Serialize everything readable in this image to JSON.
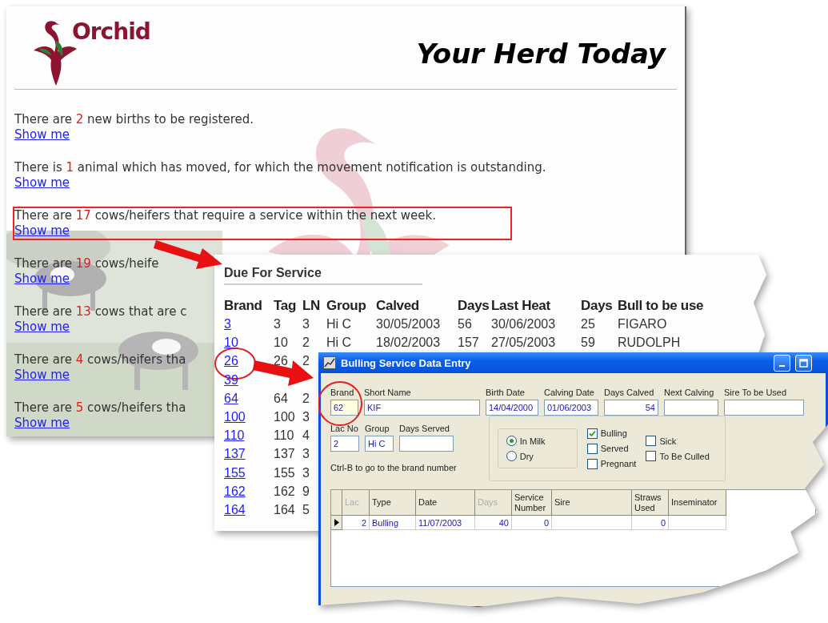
{
  "herd_page": {
    "logo": {
      "text": "Orchid"
    },
    "title": "Your Herd Today",
    "items": [
      {
        "prefix": "There are ",
        "count": "2",
        "suffix": " new births to be registered.",
        "link": "Show me",
        "highlighted": false
      },
      {
        "prefix": "There is ",
        "count": "1",
        "suffix": " animal which has moved, for which the movement notification is outstanding.",
        "link": "Show me",
        "highlighted": false
      },
      {
        "prefix": "There are ",
        "count": "17",
        "suffix": " cows/heifers that require a service within the next week.",
        "link": "Show me",
        "highlighted": true
      },
      {
        "prefix": "There are ",
        "count": "19",
        "suffix": " cows/heife",
        "link": "Show me",
        "highlighted": false
      },
      {
        "prefix": "There are ",
        "count": "13",
        "suffix": " cows that are c",
        "link": "Show me",
        "highlighted": false
      },
      {
        "prefix": "There are ",
        "count": "4",
        "suffix": " cows/heifers tha",
        "link": "Show me",
        "highlighted": false
      },
      {
        "prefix": "There are ",
        "count": "5",
        "suffix": " cows/heifers tha",
        "link": "Show me",
        "highlighted": false
      }
    ]
  },
  "due_for_service": {
    "title": "Due For Service",
    "columns": [
      "Brand",
      "Tag",
      "LN",
      "Group",
      "Calved",
      "Days",
      "Last Heat",
      "Days",
      "Bull to be use"
    ],
    "rows": [
      {
        "circled": false,
        "cells": [
          "3",
          "3",
          "3",
          "Hi C",
          "30/05/2003",
          "56",
          "30/06/2003",
          "25",
          "FIGARO"
        ]
      },
      {
        "circled": false,
        "cells": [
          "10",
          "10",
          "2",
          "Hi C",
          "18/02/2003",
          "157",
          "27/05/2003",
          "59",
          "RUDOLPH"
        ]
      },
      {
        "circled": true,
        "cells": [
          "26",
          "26",
          "2"
        ]
      },
      {
        "circled": false,
        "cells": [
          "39"
        ]
      },
      {
        "circled": false,
        "cells": [
          "64",
          "64",
          "2"
        ]
      },
      {
        "circled": false,
        "cells": [
          "100",
          "100",
          "3"
        ]
      },
      {
        "circled": false,
        "cells": [
          "110",
          "110",
          "4"
        ]
      },
      {
        "circled": false,
        "cells": [
          "137",
          "137",
          "3"
        ]
      },
      {
        "circled": false,
        "cells": [
          "155",
          "155",
          "3"
        ]
      },
      {
        "circled": false,
        "cells": [
          "162",
          "162",
          "9"
        ]
      },
      {
        "circled": false,
        "cells": [
          "164",
          "164",
          "5"
        ]
      }
    ]
  },
  "dialog": {
    "title": "Bulling Service Data Entry",
    "fields": [
      {
        "label": "Brand",
        "value": "62",
        "kind": "selected",
        "circled": true
      },
      {
        "label": "Short Name",
        "value": "KIF",
        "kind": "text",
        "circled": false
      },
      {
        "label": "Birth Date",
        "value": "14/04/2000",
        "kind": "text",
        "circled": false
      },
      {
        "label": "Calving Date",
        "value": "01/06/2003",
        "kind": "text",
        "circled": false
      },
      {
        "label": "Days Calved",
        "value": "54",
        "kind": "number",
        "circled": false
      },
      {
        "label": "Next Calving",
        "circled": false
      },
      {
        "label": "Sire To be Used",
        "circled": false
      }
    ],
    "fields_row2": [
      {
        "label": "Lac No",
        "value": "2",
        "circled": false
      },
      {
        "label": "Group",
        "value": "Hi C",
        "circled": false
      },
      {
        "label": "Days Served",
        "circled": false
      }
    ],
    "hint": "Ctrl-B to go to the brand number",
    "radios": [
      {
        "label": "In Milk",
        "selected": true
      },
      {
        "label": "Dry",
        "selected": false
      }
    ],
    "checkboxes": [
      {
        "label": "Bulling",
        "checked": true
      },
      {
        "label": "Served",
        "checked": false
      },
      {
        "label": "Pregnant",
        "checked": false
      },
      {
        "label": "Sick",
        "checked": false
      },
      {
        "label": "To Be Culled",
        "checked": false
      }
    ],
    "grid": {
      "columns": [
        {
          "label": "Lac",
          "kind": "number",
          "disabled": true
        },
        {
          "label": "Type",
          "kind": "text",
          "disabled": false
        },
        {
          "label": "Date",
          "kind": "text",
          "disabled": false
        },
        {
          "label": "Days",
          "kind": "number",
          "disabled": true
        },
        {
          "label": "Service Number",
          "kind": "number",
          "disabled": false
        },
        {
          "label": "Sire",
          "kind": "text",
          "disabled": false
        },
        {
          "label": "Straws Used",
          "kind": "number",
          "disabled": false
        },
        {
          "label": "Inseminator",
          "kind": "text",
          "disabled": false
        }
      ],
      "rows": [
        {
          "current": true,
          "cells": [
            "2",
            "Bulling",
            "11/07/2003",
            "40",
            "0",
            null,
            "0",
            null
          ]
        }
      ]
    }
  }
}
